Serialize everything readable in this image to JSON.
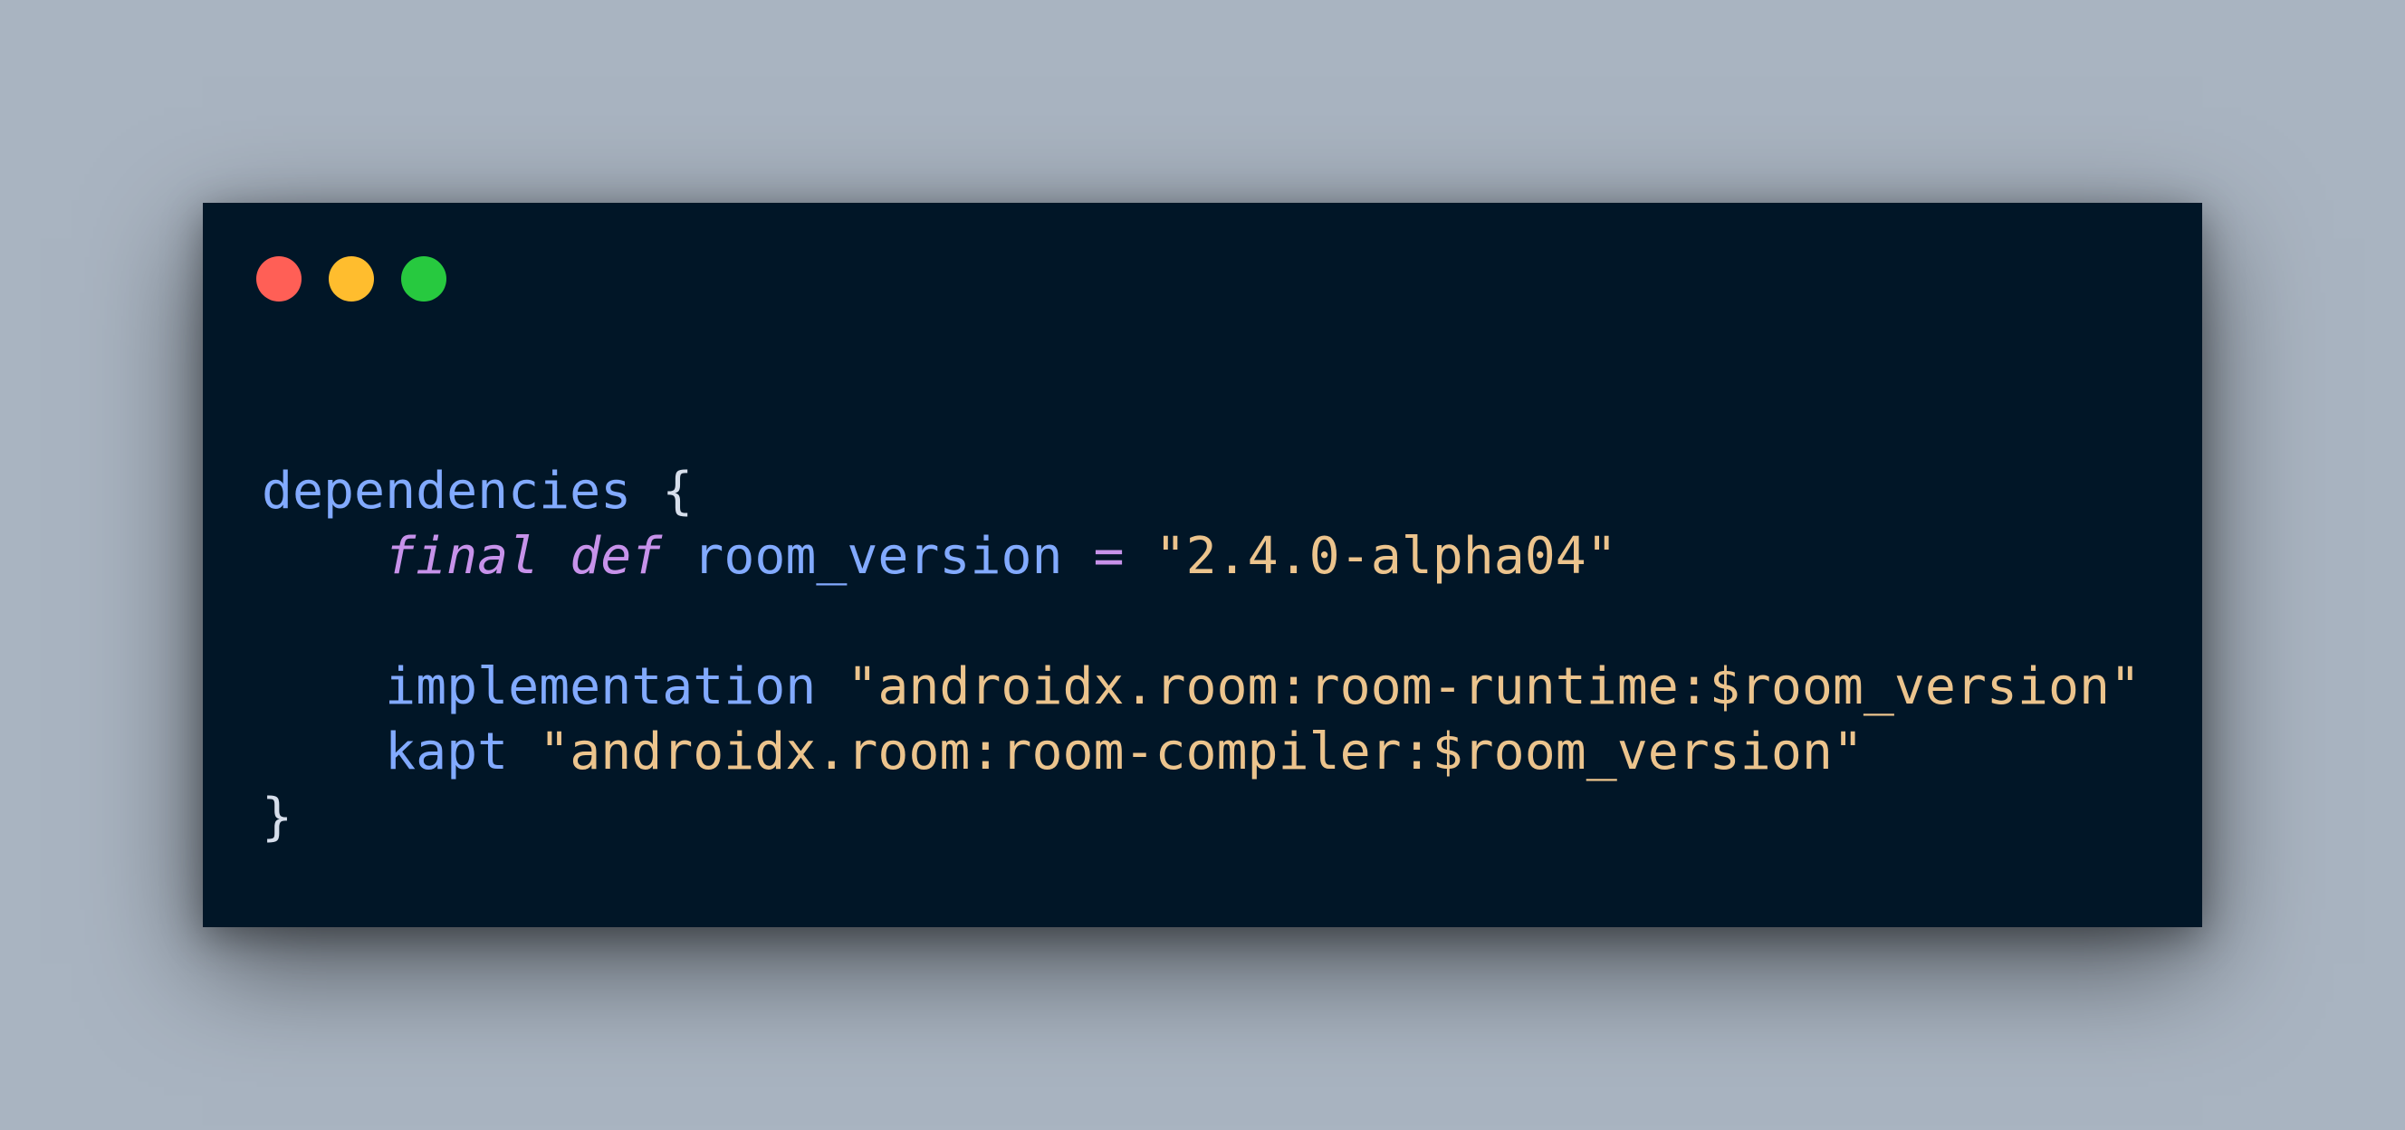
{
  "window": {
    "controls": [
      {
        "name": "close",
        "color": "#ff5f56"
      },
      {
        "name": "minimize",
        "color": "#ffbd2e"
      },
      {
        "name": "maximize",
        "color": "#27c93f"
      }
    ]
  },
  "code": {
    "line1": {
      "ident": "dependencies",
      "brace": "{"
    },
    "line2": {
      "indent": "    ",
      "kw1": "final",
      "kw2": "def",
      "ident": "room_version",
      "op": "=",
      "str": "\"2.4.0-alpha04\""
    },
    "line4": {
      "indent": "    ",
      "ident": "implementation",
      "str": "\"androidx.room:room-runtime:$room_version\""
    },
    "line5": {
      "indent": "    ",
      "ident": "kapt",
      "str": "\"androidx.room:room-compiler:$room_version\""
    },
    "line6": {
      "brace": "}"
    }
  }
}
